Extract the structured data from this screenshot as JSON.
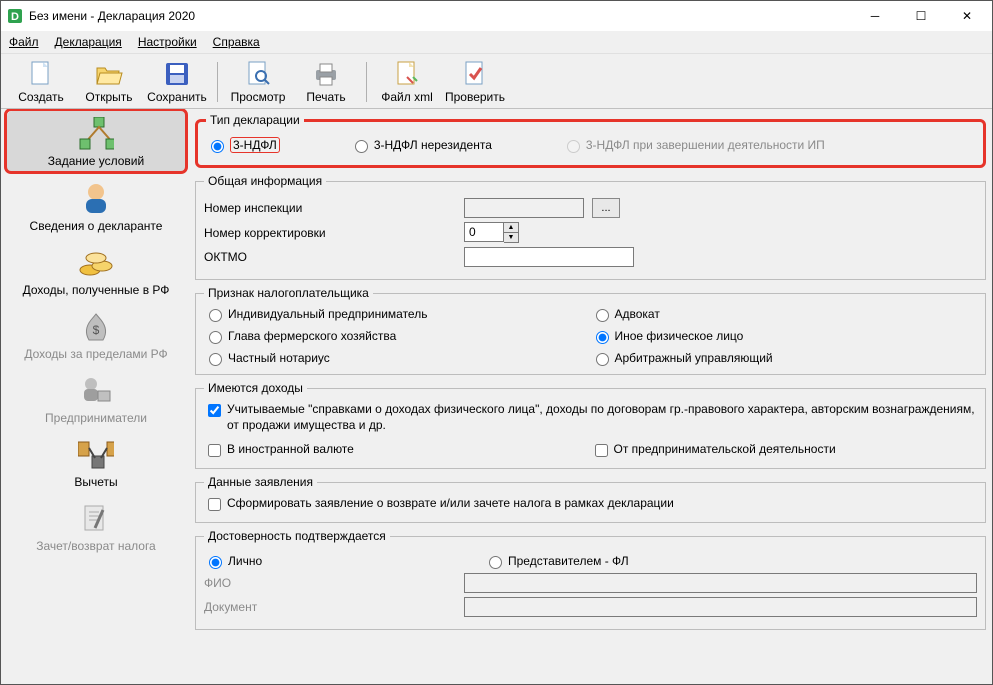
{
  "window": {
    "title": "Без имени - Декларация 2020"
  },
  "menu": {
    "file": "Файл",
    "decl": "Декларация",
    "settings": "Настройки",
    "help": "Справка"
  },
  "toolbar": {
    "create": "Создать",
    "open": "Открыть",
    "save": "Сохранить",
    "preview": "Просмотр",
    "print": "Печать",
    "filexml": "Файл xml",
    "check": "Проверить"
  },
  "sidebar": {
    "items": [
      {
        "label": "Задание условий"
      },
      {
        "label": "Сведения о декларанте"
      },
      {
        "label": "Доходы, полученные в РФ"
      },
      {
        "label": "Доходы за пределами РФ"
      },
      {
        "label": "Предприниматели"
      },
      {
        "label": "Вычеты"
      },
      {
        "label": "Зачет/возврат налога"
      }
    ]
  },
  "form": {
    "decl_type": {
      "legend": "Тип декларации",
      "opt1": "3-НДФЛ",
      "opt2": "3-НДФЛ нерезидента",
      "opt3": "3-НДФЛ при завершении деятельности ИП"
    },
    "general": {
      "legend": "Общая информация",
      "inspection": "Номер инспекции",
      "browse": "...",
      "correction": "Номер корректировки",
      "correction_value": "0",
      "oktmo": "ОКТМО"
    },
    "taxpayer": {
      "legend": "Признак налогоплательщика",
      "opt1": "Индивидуальный предприниматель",
      "opt2": "Адвокат",
      "opt3": "Глава фермерского хозяйства",
      "opt4": "Иное физическое лицо",
      "opt5": "Частный нотариус",
      "opt6": "Арбитражный управляющий"
    },
    "income": {
      "legend": "Имеются доходы",
      "chk1": "Учитываемые \"справками о доходах физического лица\", доходы по договорам гр.-правового характера, авторским вознаграждениям, от продажи имущества и др.",
      "chk2": "В иностранной валюте",
      "chk3": "От предпринимательской деятельности"
    },
    "application": {
      "legend": "Данные заявления",
      "chk1": "Сформировать заявление о  возврате и/или  зачете налога в рамках декларации"
    },
    "reliability": {
      "legend": "Достоверность подтверждается",
      "opt1": "Лично",
      "opt2": "Представителем - ФЛ",
      "fio": "ФИО",
      "doc": "Документ"
    }
  }
}
